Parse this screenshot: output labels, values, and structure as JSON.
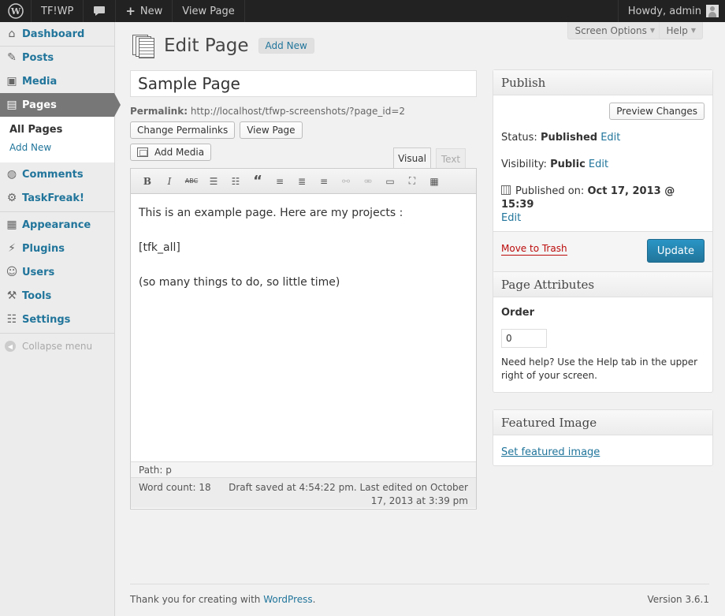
{
  "adminbar": {
    "site_name": "TF!WP",
    "new_label": "New",
    "view_page": "View Page",
    "howdy": "Howdy, admin"
  },
  "sidebar": {
    "items": [
      {
        "label": "Dashboard"
      },
      {
        "label": "Posts"
      },
      {
        "label": "Media"
      },
      {
        "label": "Pages"
      },
      {
        "label": "Comments"
      },
      {
        "label": "TaskFreak!"
      },
      {
        "label": "Appearance"
      },
      {
        "label": "Plugins"
      },
      {
        "label": "Users"
      },
      {
        "label": "Tools"
      },
      {
        "label": "Settings"
      }
    ],
    "submenu": [
      "All Pages",
      "Add New"
    ],
    "collapse": "Collapse menu"
  },
  "header": {
    "screen_options": "Screen Options",
    "help": "Help",
    "title": "Edit Page",
    "add_new": "Add New"
  },
  "editor": {
    "post_title": "Sample Page",
    "permalink_label": "Permalink:",
    "permalink_url": "http://localhost/tfwp-screenshots/?page_id=2",
    "change_permalinks": "Change Permalinks",
    "view_page": "View Page",
    "add_media": "Add Media",
    "tab_visual": "Visual",
    "tab_text": "Text",
    "toolbar_bold": "B",
    "toolbar_italic": "I",
    "toolbar_strike": "ABC",
    "content": [
      "This is an example page. Here are my projects :",
      "[tfk_all]",
      "(so many things to do, so little time)"
    ],
    "path": "Path: p",
    "word_count": "Word count: 18",
    "autosave": "Draft saved at 4:54:22 pm. Last edited on October 17, 2013 at 3:39 pm"
  },
  "publish": {
    "title": "Publish",
    "preview": "Preview Changes",
    "status_label": "Status:",
    "status_value": "Published",
    "visibility_label": "Visibility:",
    "visibility_value": "Public",
    "published_label": "Published on:",
    "published_value": "Oct 17, 2013 @ 15:39",
    "edit": "Edit",
    "trash": "Move to Trash",
    "update": "Update"
  },
  "attributes": {
    "title": "Page Attributes",
    "order_label": "Order",
    "order_value": "0",
    "help": "Need help? Use the Help tab in the upper right of your screen."
  },
  "featured": {
    "title": "Featured Image",
    "link": "Set featured image"
  },
  "footer": {
    "thanks": "Thank you for creating with",
    "wordpress": "WordPress",
    "version": "Version 3.6.1"
  }
}
